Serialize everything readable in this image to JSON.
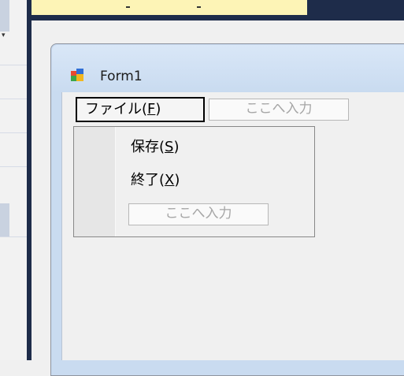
{
  "form": {
    "title": "Form1",
    "icon": "winform-app-icon"
  },
  "menubar": {
    "file_menu": {
      "label": "ファイル(",
      "mnemonic": "F",
      "close": ")"
    },
    "type_here": "ここへ入力"
  },
  "dropdown": {
    "items": [
      {
        "label": "保存(",
        "mnemonic": "S",
        "close": ")"
      },
      {
        "label": "終了(",
        "mnemonic": "X",
        "close": ")"
      }
    ],
    "type_here": "ここへ入力"
  },
  "colors": {
    "accent_dark": "#1e2c4a",
    "highlight_yellow": "#fdf4b6",
    "form_caption": "#c9dbf0"
  }
}
